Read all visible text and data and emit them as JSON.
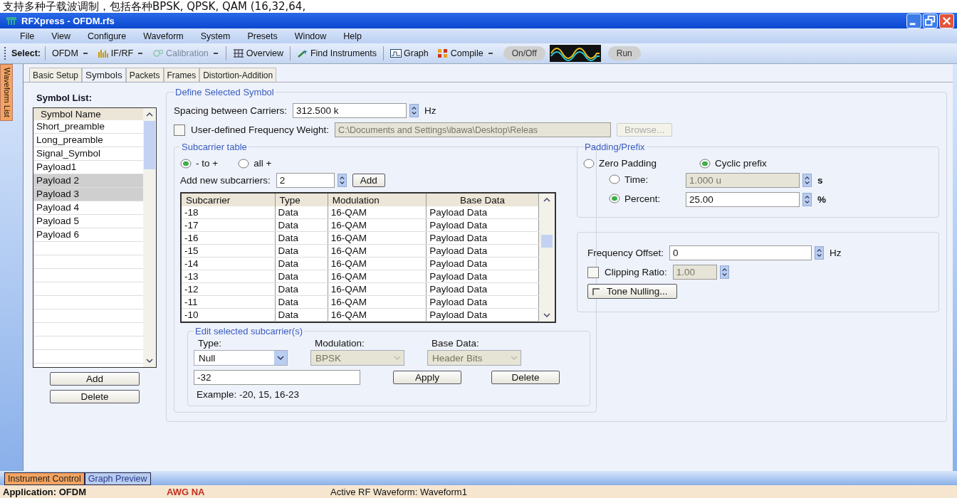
{
  "caption": "支持多种子载波调制，包括各种BPSK, QPSK, QAM (16,32,64,",
  "window": {
    "title": "RFXpress - OFDM.rfs"
  },
  "menu": [
    "File",
    "View",
    "Configure",
    "Waveform",
    "System",
    "Presets",
    "Window",
    "Help"
  ],
  "toolbar": [
    {
      "kind": "label",
      "label": "Select:"
    },
    {
      "kind": "dropdown",
      "label": "OFDM",
      "disabled": false
    },
    {
      "kind": "dropdown",
      "label": "IF/RF",
      "disabled": false
    },
    {
      "kind": "dropdown",
      "label": "Calibration",
      "disabled": true
    },
    {
      "kind": "button",
      "label": "Overview",
      "disabled": false
    },
    {
      "kind": "button",
      "label": "Find Instruments",
      "disabled": false
    },
    {
      "kind": "button",
      "label": "Graph",
      "disabled": false
    },
    {
      "kind": "dropdown",
      "label": "Compile",
      "disabled": false
    },
    {
      "kind": "pill",
      "label": "On/Off"
    },
    {
      "kind": "scope"
    },
    {
      "kind": "pill",
      "label": "Run"
    }
  ],
  "side_tab": "Waveform List",
  "tabs": [
    {
      "label": "Basic Setup",
      "selected": false
    },
    {
      "label": "Symbols",
      "selected": true
    },
    {
      "label": "Packets",
      "selected": false
    },
    {
      "label": "Frames",
      "selected": false
    },
    {
      "label": "Distortion-Addition",
      "selected": false
    }
  ],
  "symbol_list": {
    "title": "Symbol List:",
    "header": "Symbol Name",
    "items": [
      {
        "name": "Short_preamble",
        "selected": false
      },
      {
        "name": "Long_preamble",
        "selected": false
      },
      {
        "name": "Signal_Symbol",
        "selected": false
      },
      {
        "name": "Payload1",
        "selected": false
      },
      {
        "name": "Payload 2",
        "selected": true
      },
      {
        "name": "Payload 3",
        "selected": true
      },
      {
        "name": "Payload 4",
        "selected": false
      },
      {
        "name": "Payload 5",
        "selected": false
      },
      {
        "name": "Payload 6",
        "selected": false
      }
    ],
    "buttons": [
      "Add",
      "Delete"
    ]
  },
  "define_symbol": {
    "title": "Define Selected Symbol",
    "spacing": {
      "label": "Spacing between Carriers:",
      "value": "312.500 k",
      "unit": "Hz"
    },
    "weight": {
      "label": "User-defined Frequency Weight:",
      "checked": false,
      "path": "C:\\Documents and Settings\\ibawa\\Desktop\\Releas",
      "browse": "Browse..."
    }
  },
  "subcarrier_table": {
    "title": "Subcarrier table",
    "radios": [
      {
        "label": "- to +",
        "selected": true
      },
      {
        "label": "all +",
        "selected": false
      }
    ],
    "add_label": "Add new subcarriers:",
    "add_value": "2",
    "add_button": "Add",
    "columns": [
      "Subcarrier",
      "Type",
      "Modulation",
      "Base Data"
    ],
    "rows": [
      [
        "-18",
        "Data",
        "16-QAM",
        "Payload Data"
      ],
      [
        "-17",
        "Data",
        "16-QAM",
        "Payload Data"
      ],
      [
        "-16",
        "Data",
        "16-QAM",
        "Payload Data"
      ],
      [
        "-15",
        "Data",
        "16-QAM",
        "Payload Data"
      ],
      [
        "-14",
        "Data",
        "16-QAM",
        "Payload Data"
      ],
      [
        "-13",
        "Data",
        "16-QAM",
        "Payload Data"
      ],
      [
        "-12",
        "Data",
        "16-QAM",
        "Payload Data"
      ],
      [
        "-11",
        "Data",
        "16-QAM",
        "Payload Data"
      ],
      [
        "-10",
        "Data",
        "16-QAM",
        "Payload Data"
      ]
    ]
  },
  "edit_subcarrier": {
    "title": "Edit selected subcarrier(s)",
    "selects": [
      {
        "label": "Type:",
        "value": "Null",
        "disabled": false
      },
      {
        "label": "Modulation:",
        "value": "BPSK",
        "disabled": true
      },
      {
        "label": "Base Data:",
        "value": "Header Bits",
        "disabled": true
      }
    ],
    "value": "-32",
    "buttons": [
      "Apply",
      "Delete"
    ],
    "example": "Example: -20, 15, 16-23"
  },
  "padding": {
    "title": "Padding/Prefix",
    "modes": [
      {
        "label": "Zero Padding",
        "selected": false
      },
      {
        "label": "Cyclic prefix",
        "selected": true
      }
    ],
    "options": [
      {
        "label": "Time:",
        "value": "1.000 u",
        "unit": "s",
        "selected": false
      },
      {
        "label": "Percent:",
        "value": "25.00",
        "unit": "%",
        "selected": true
      }
    ]
  },
  "offset": {
    "label": "Frequency Offset:",
    "value": "0",
    "unit": "Hz",
    "clipping": {
      "label": "Clipping Ratio:",
      "checked": false,
      "value": "1.00"
    },
    "tone_button": "Tone Nulling..."
  },
  "bottom_tabs": [
    {
      "label": "Instrument Control",
      "selected": true
    },
    {
      "label": "Graph Preview",
      "selected": false
    }
  ],
  "status": [
    {
      "kind": "bold",
      "text": "Application: OFDM"
    },
    {
      "kind": "alert",
      "text": "AWG NA"
    },
    {
      "kind": "plain",
      "text": "Active RF Waveform: Waveform1"
    }
  ]
}
